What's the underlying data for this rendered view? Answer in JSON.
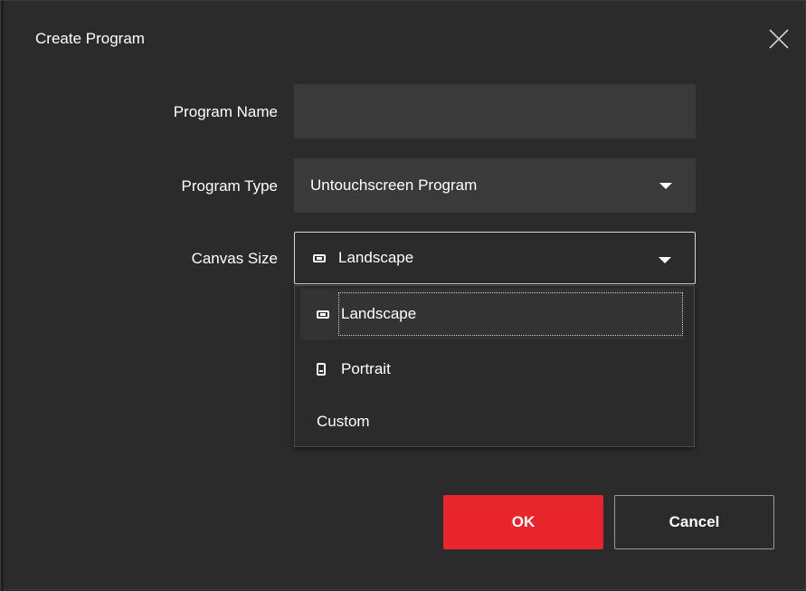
{
  "dialog": {
    "title": "Create Program",
    "close_icon": "close-icon"
  },
  "form": {
    "program_name": {
      "label": "Program Name",
      "value": "",
      "placeholder": ""
    },
    "program_type": {
      "label": "Program Type",
      "value": "Untouchscreen Program",
      "icon": "chevron-down-icon"
    },
    "canvas_size": {
      "label": "Canvas Size",
      "value": "Landscape",
      "value_icon": "landscape-icon",
      "icon": "chevron-down-icon",
      "options": [
        {
          "label": "Landscape",
          "icon": "landscape-icon",
          "selected": true
        },
        {
          "label": "Portrait",
          "icon": "portrait-icon",
          "selected": false
        },
        {
          "label": "Custom",
          "icon": "",
          "selected": false
        }
      ]
    }
  },
  "buttons": {
    "ok_label": "OK",
    "cancel_label": "Cancel"
  },
  "colors": {
    "background": "#2b2b2b",
    "field": "#3a3a3a",
    "accent": "#e8252d",
    "text": "#ffffff"
  }
}
